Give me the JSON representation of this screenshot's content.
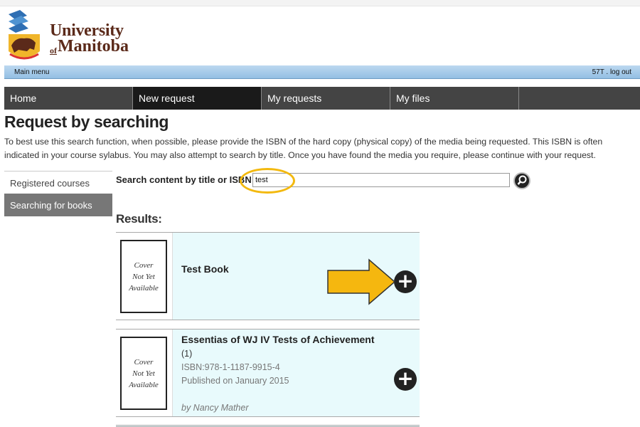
{
  "brand": {
    "line1": "University",
    "of": "of",
    "line2": "Manitoba"
  },
  "menubar": {
    "main_menu": "Main menu",
    "user": "57T . log out"
  },
  "nav": [
    {
      "label": "Home"
    },
    {
      "label": "New request",
      "active": true
    },
    {
      "label": "My requests"
    },
    {
      "label": "My files"
    },
    {
      "label": ""
    }
  ],
  "page": {
    "title": "Request by searching",
    "intro": "To best use this search function, when possible, please provide the ISBN of the hard copy (physical copy) of the media being requested. This ISBN is often indicated in your course sylabus. You may also attempt to search by title. Once you have found the media you require, please continue with your request."
  },
  "side_menu": [
    {
      "label": "Registered courses"
    },
    {
      "label": "Searching for books",
      "active": true
    }
  ],
  "search": {
    "label": "Search content by title or ISBN",
    "value": "test",
    "button_icon": "search-icon"
  },
  "results": {
    "heading": "Results:",
    "cover_text": [
      "Cover",
      "Not Yet",
      "Available"
    ],
    "items": [
      {
        "title": "Test Book"
      },
      {
        "title": "Essentias of WJ IV Tests of Achievement",
        "edition": "(1)",
        "isbn": "ISBN:978-1-1187-9915-4",
        "published": "Published on January 2015",
        "author": "by Nancy Mather"
      }
    ]
  },
  "colors": {
    "nav_bg": "#444444",
    "nav_active": "#1a1a1a",
    "menubar": "#93bfe3",
    "card_bg": "#e8fafc",
    "highlight": "#f3b90f",
    "brand_text": "#5b2a1a"
  },
  "annotations": {
    "arrow_icon": "arrow-right-icon",
    "highlight": "highlight-ring"
  }
}
